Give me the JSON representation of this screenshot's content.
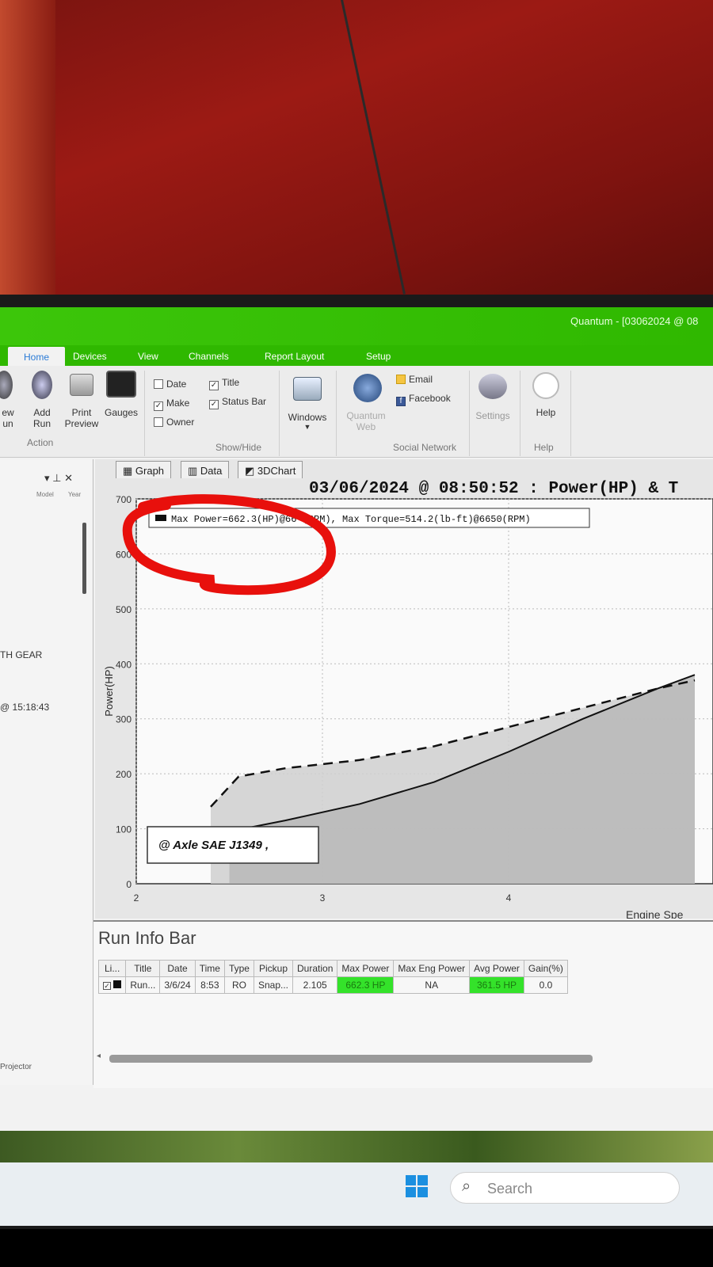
{
  "window": {
    "title": "Quantum - [03062024 @ 08"
  },
  "ribbon_tabs": [
    "Home",
    "Devices",
    "View",
    "Channels",
    "Report Layout",
    "Setup"
  ],
  "ribbon": {
    "action": {
      "new_run": "ew\nun",
      "add_run": "Add\nRun",
      "print_preview": "Print\nPreview",
      "gauges": "Gauges",
      "group": "Action"
    },
    "showhide": {
      "date": "Date",
      "title": "Title",
      "make": "Make",
      "status_bar": "Status Bar",
      "owner": "Owner",
      "group": "Show/Hide",
      "checked": {
        "date": false,
        "title": true,
        "make": true,
        "status_bar": true,
        "owner": false
      }
    },
    "windows": "Windows",
    "social": {
      "quantum_web": "Quantum\nWeb",
      "email": "Email",
      "facebook": "Facebook",
      "group": "Social Network"
    },
    "settings": "Settings",
    "help": "Help",
    "help_group": "Help"
  },
  "left_panel": {
    "col_model": "Model",
    "col_year": "Year",
    "row1": "TH GEAR",
    "row2": "@ 15:18:43",
    "bottom": "Projector"
  },
  "graph_tabs": [
    "Graph",
    "Data",
    "3DChart"
  ],
  "chart_data": {
    "type": "line",
    "title": "03/06/2024 @ 08:50:52 : Power(HP) & T",
    "ylabel": "Power(HP)",
    "xlabel": "Engine Spe",
    "ylim": [
      0,
      700
    ],
    "xlim": [
      2,
      5
    ],
    "yticks": [
      "0",
      "100",
      "200",
      "300",
      "400",
      "500",
      "600",
      "700"
    ],
    "xticks": [
      "2",
      "3",
      "4"
    ],
    "legend": "Max Power=662.3(HP)@66  (RPM), Max Torque=514.2(lb-ft)@6650(RPM)",
    "annotation": "@ Axle SAE J1349  ,",
    "series": [
      {
        "style": "solid",
        "x": [
          2.5,
          2.8,
          3.2,
          3.6,
          4.0,
          4.4,
          4.8,
          5.0
        ],
        "values": [
          95,
          115,
          145,
          185,
          240,
          300,
          355,
          380
        ]
      },
      {
        "style": "dashed",
        "x": [
          2.4,
          2.55,
          2.8,
          3.2,
          3.6,
          4.0,
          4.4,
          4.8,
          5.0
        ],
        "values": [
          140,
          195,
          210,
          225,
          250,
          285,
          320,
          355,
          370
        ]
      }
    ]
  },
  "run_info": {
    "title": "Run Info Bar",
    "columns": [
      "Li...",
      "Title",
      "Date",
      "Time",
      "Type",
      "Pickup",
      "Duration",
      "Max Power",
      "Max Eng Power",
      "Avg Power",
      "Gain(%)"
    ],
    "rows": [
      [
        "",
        "Run...",
        "3/6/24",
        "8:53",
        "RO",
        "Snap...",
        "2.105",
        "662.3 HP",
        "NA",
        "361.5 HP",
        "0.0"
      ]
    ]
  },
  "taskbar": {
    "search": "Search"
  }
}
